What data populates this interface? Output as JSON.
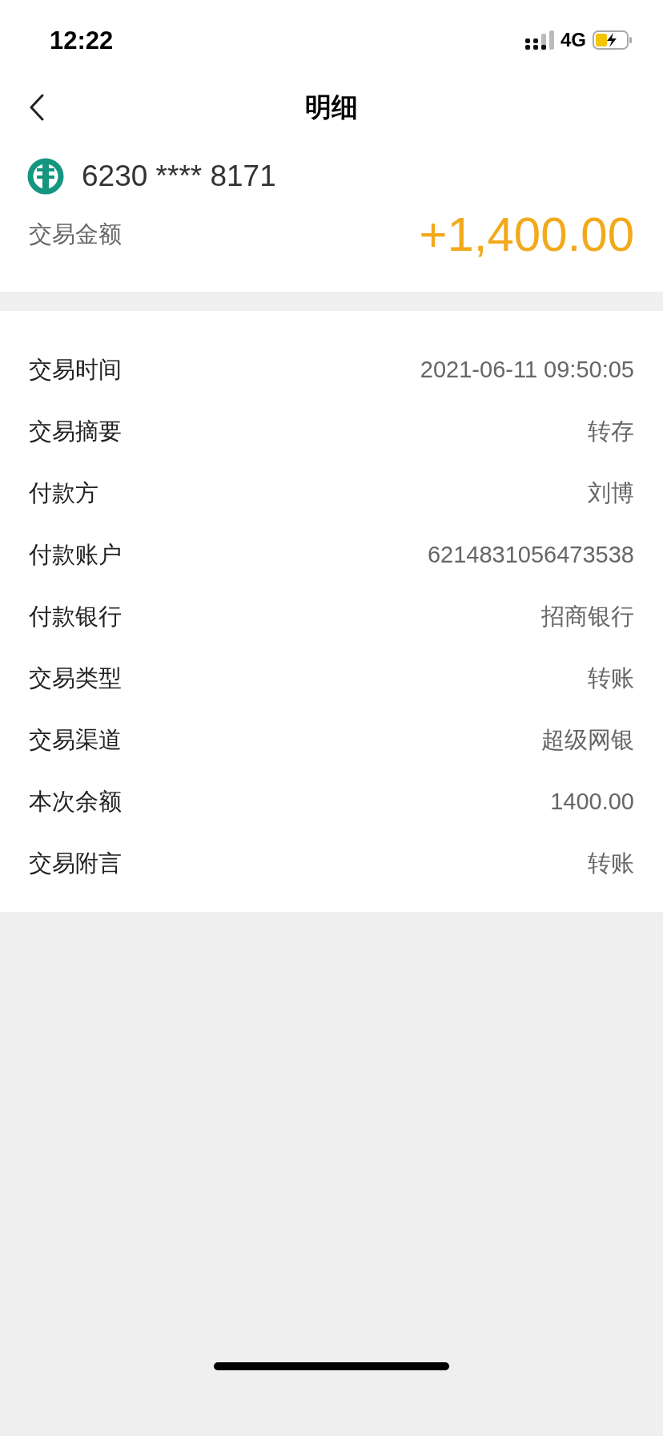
{
  "status_bar": {
    "time": "12:22",
    "network": "4G"
  },
  "nav": {
    "title": "明细"
  },
  "account": {
    "card_number": "6230 **** 8171",
    "amount_label": "交易金额",
    "amount": "+1,400.00"
  },
  "details": [
    {
      "label": "交易时间",
      "value": "2021-06-11 09:50:05"
    },
    {
      "label": "交易摘要",
      "value": "转存"
    },
    {
      "label": "付款方",
      "value": "刘博"
    },
    {
      "label": "付款账户",
      "value": "6214831056473538"
    },
    {
      "label": "付款银行",
      "value": "招商银行"
    },
    {
      "label": "交易类型",
      "value": "转账"
    },
    {
      "label": "交易渠道",
      "value": "超级网银"
    },
    {
      "label": "本次余额",
      "value": "1400.00"
    },
    {
      "label": "交易附言",
      "value": "转账"
    }
  ]
}
